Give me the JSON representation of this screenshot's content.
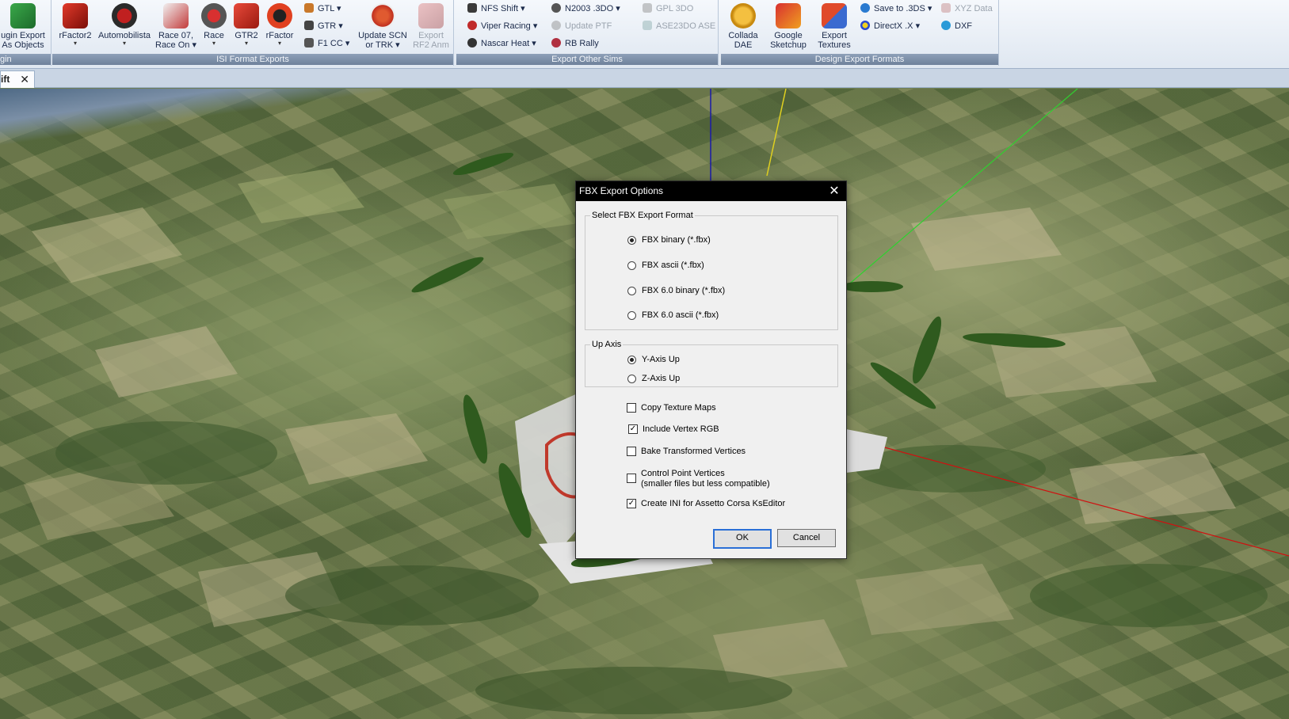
{
  "ribbon": {
    "groups": [
      {
        "label": "gin"
      },
      {
        "label": "ISI Format Exports"
      },
      {
        "label": "Export Other Sims"
      },
      {
        "label": "Design Export Formats"
      }
    ],
    "plugin": {
      "label1": "ugin Export",
      "label2": "As Objects"
    },
    "isi": {
      "rfactor2": "rFactor2",
      "automobilista": "Automobilista",
      "race07_1": "Race 07,",
      "race07_2": "Race On",
      "race": "Race",
      "gtr2": "GTR2",
      "rfactor": "rFactor",
      "gtl": "GTL",
      "gtr": "GTR",
      "f1cc": "F1 CC",
      "update_scn_1": "Update SCN",
      "update_scn_2": "or TRK",
      "export_rf2_1": "Export",
      "export_rf2_2": "RF2 Anm"
    },
    "other_sims": {
      "nfs_shift": "NFS Shift",
      "viper_racing": "Viper Racing",
      "nascar_heat": "Nascar Heat",
      "n2003": "N2003 .3DO",
      "update_ptf": "Update PTF",
      "rb_rally": "RB Rally",
      "gpl_3do": "GPL 3DO",
      "ase23do": "ASE23DO ASE"
    },
    "design": {
      "collada_1": "Collada",
      "collada_2": "DAE",
      "sketchup_1": "Google",
      "sketchup_2": "Sketchup",
      "textures_1": "Export",
      "textures_2": "Textures",
      "save_3ds": "Save to .3DS",
      "directx": "DirectX .X",
      "xyz": "XYZ Data",
      "dxf": "DXF"
    }
  },
  "tabs": [
    {
      "label": "ift"
    }
  ],
  "dialog": {
    "title": "FBX Export Options",
    "format_group": "Select FBX Export Format",
    "formats": [
      {
        "label": "FBX binary (*.fbx)",
        "selected": true
      },
      {
        "label": "FBX ascii (*.fbx)",
        "selected": false
      },
      {
        "label": "FBX 6.0 binary (*.fbx)",
        "selected": false
      },
      {
        "label": "FBX 6.0 ascii (*.fbx)",
        "selected": false
      }
    ],
    "axis_group": "Up Axis",
    "axes": [
      {
        "label": "Y-Axis Up",
        "selected": true
      },
      {
        "label": "Z-Axis Up",
        "selected": false
      }
    ],
    "options": [
      {
        "label": "Copy Texture Maps",
        "checked": false
      },
      {
        "label": "Include Vertex RGB",
        "checked": true
      },
      {
        "label": "Bake Transformed Vertices",
        "checked": false
      },
      {
        "label": "Control Point Vertices",
        "label2": "(smaller files but less compatible)",
        "checked": false
      },
      {
        "label": "Create INI for Assetto Corsa KsEditor",
        "checked": true
      }
    ],
    "ok_label": "OK",
    "cancel_label": "Cancel"
  },
  "colors": {
    "axis_x": "#d01010",
    "axis_y": "#30d030",
    "axis_z": "#1a1aaa",
    "axis_guide": "#e0d020"
  }
}
